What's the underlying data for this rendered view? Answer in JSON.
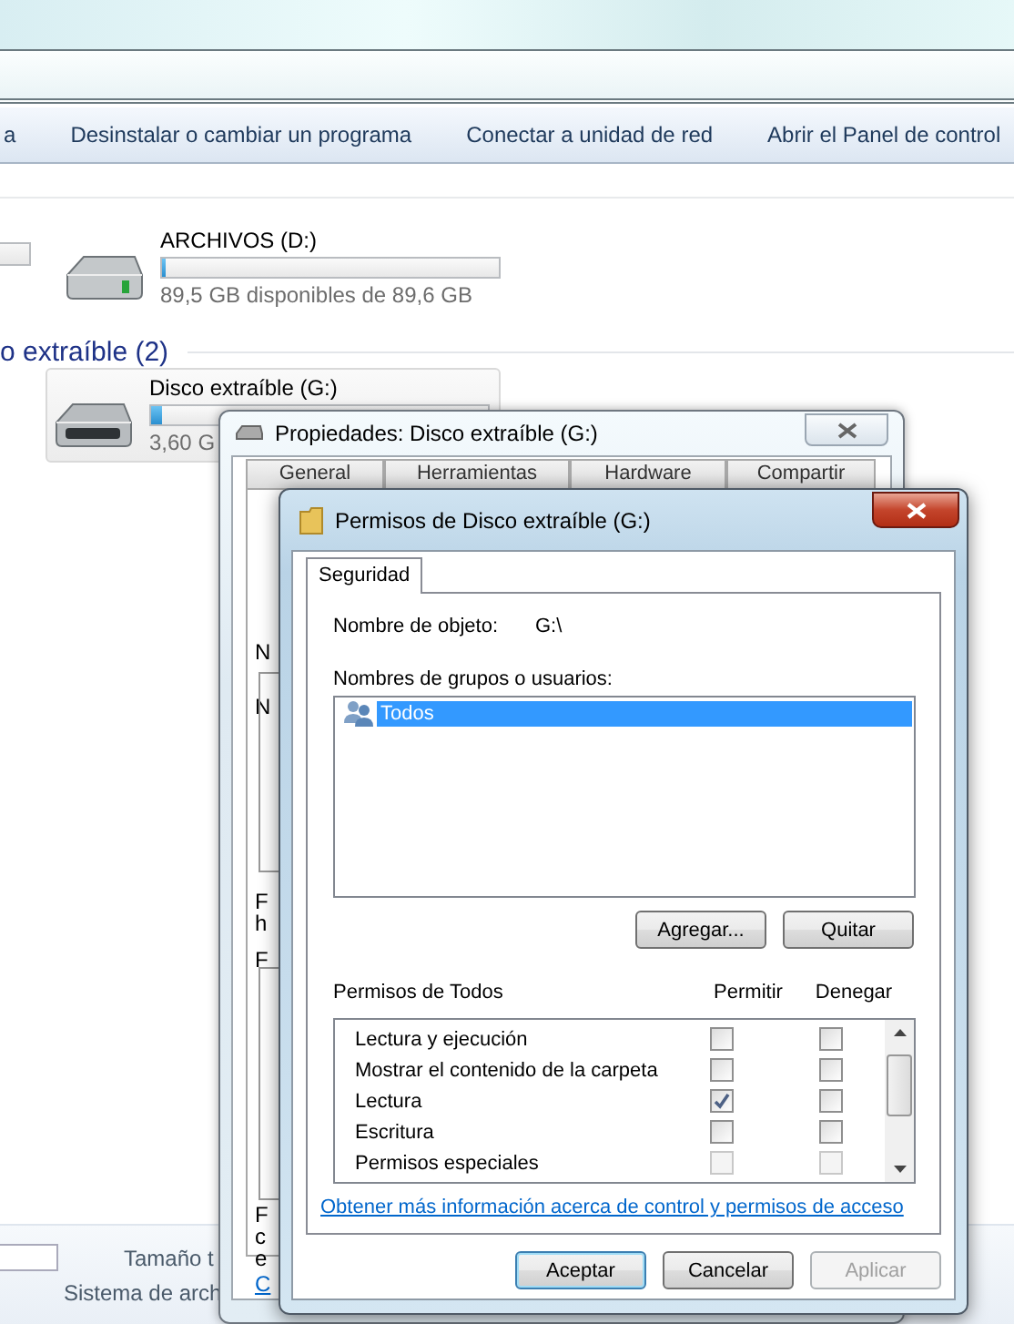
{
  "explorer": {
    "toolbar": [
      {
        "label": "a"
      },
      {
        "label": "Desinstalar o cambiar un programa"
      },
      {
        "label": "Conectar a unidad de red"
      },
      {
        "label": "Abrir el Panel de control"
      }
    ],
    "drives": [
      {
        "kind": "hdd",
        "name": "ARCHIVOS (D:)",
        "level": 0.01,
        "free": "89,5 GB disponibles de 89,6 GB",
        "selected": false
      },
      {
        "kind": "removable",
        "name": "Disco extraíble (G:)",
        "level": 0.03,
        "free": "3,60 G",
        "selected": true
      }
    ],
    "group_header": "o extraíble (2)",
    "details": [
      "Tamaño t",
      "Sistema de arch"
    ]
  },
  "properties": {
    "title": "Propiedades: Disco extraíble (G:)",
    "tabs": [
      "General",
      "Herramientas",
      "Hardware",
      "Compartir"
    ],
    "fragments": [
      {
        "kind": "text",
        "text": "N"
      },
      {
        "kind": "text",
        "text": "N"
      },
      {
        "kind": "text",
        "text": "F"
      },
      {
        "kind": "text",
        "text": "h"
      },
      {
        "kind": "text",
        "text": "F"
      },
      {
        "kind": "text",
        "text": "F"
      },
      {
        "kind": "text",
        "text": "c"
      },
      {
        "kind": "text",
        "text": "e"
      },
      {
        "kind": "link",
        "text": "C"
      }
    ]
  },
  "permissions": {
    "title": "Permisos de Disco extraíble (G:)",
    "tabs": [
      {
        "label": "Seguridad",
        "selected": true
      }
    ],
    "object_label": "Nombre de objeto:",
    "object_value": "G:\\",
    "users_label": "Nombres de grupos o usuarios:",
    "users": [
      {
        "name": "Todos",
        "selected": true
      }
    ],
    "user_buttons": [
      "Agregar...",
      "Quitar"
    ],
    "perm_header": "Permisos de Todos",
    "allow_header": "Permitir",
    "deny_header": "Denegar",
    "perms": [
      {
        "name": "Lectura y ejecución",
        "allow": false,
        "deny": false,
        "disabled": false
      },
      {
        "name": "Mostrar el contenido de la carpeta",
        "allow": false,
        "deny": false,
        "disabled": false
      },
      {
        "name": "Lectura",
        "allow": true,
        "deny": false,
        "disabled": false
      },
      {
        "name": "Escritura",
        "allow": false,
        "deny": false,
        "disabled": false
      },
      {
        "name": "Permisos especiales",
        "allow": false,
        "deny": false,
        "disabled": true
      }
    ],
    "link": "Obtener más información acerca de control y permisos de acceso",
    "buttons": [
      {
        "label": "Aceptar",
        "default": true,
        "disabled": false
      },
      {
        "label": "Cancelar",
        "default": false,
        "disabled": false
      },
      {
        "label": "Aplicar",
        "default": false,
        "disabled": true
      }
    ]
  }
}
